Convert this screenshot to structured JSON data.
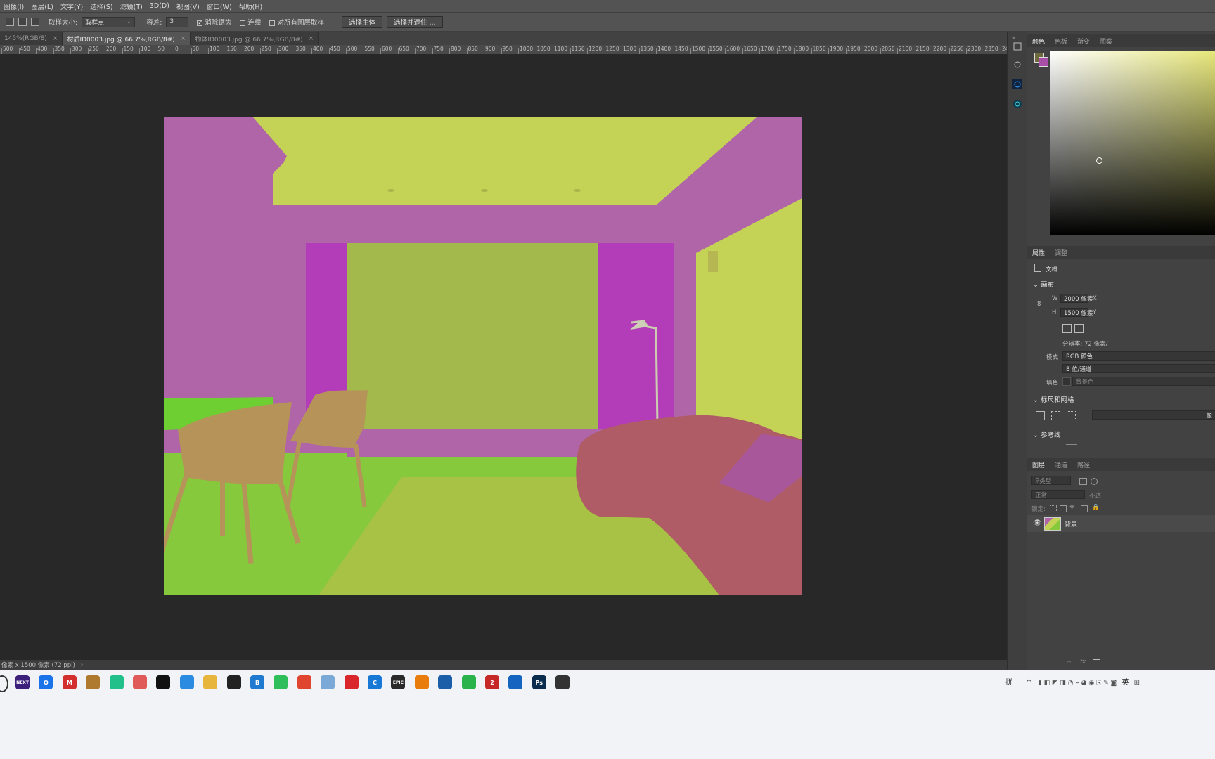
{
  "menu": [
    "图像(I)",
    "图层(L)",
    "文字(Y)",
    "选择(S)",
    "滤镜(T)",
    "3D(D)",
    "视图(V)",
    "窗口(W)",
    "帮助(H)"
  ],
  "options": {
    "sample_size_label": "取样大小:",
    "sample_size_value": "取样点",
    "tolerance_label": "容差:",
    "tolerance_value": "3",
    "antialias_label": "消除锯齿",
    "contiguous_label": "连续",
    "all_layers_label": "对所有图层取样",
    "select_subject": "选择主体",
    "select_mask": "选择并遮住 ..."
  },
  "tabs": [
    {
      "label": "145%(RGB/8)",
      "active": false
    },
    {
      "label": "材质ID0003.jpg @ 66.7%(RGB/8#)",
      "active": true
    },
    {
      "label": "物体ID0003.jpg @ 66.7%(RGB/8#)",
      "active": false
    }
  ],
  "ruler_ticks": [
    "500",
    "450",
    "400",
    "350",
    "300",
    "250",
    "200",
    "150",
    "100",
    "50",
    "0",
    "50",
    "100",
    "150",
    "200",
    "250",
    "300",
    "350",
    "400",
    "450",
    "500",
    "550",
    "600",
    "650",
    "700",
    "750",
    "800",
    "850",
    "900",
    "950",
    "1000",
    "1050",
    "1100",
    "1150",
    "1200",
    "1250",
    "1300",
    "1350",
    "1400",
    "1450",
    "1500",
    "1550",
    "1600",
    "1650",
    "1700",
    "1750",
    "1800",
    "1850",
    "1900",
    "1950",
    "2000",
    "2050",
    "2100",
    "2150",
    "2200",
    "2250",
    "2300",
    "2350",
    "2400",
    "2450",
    "2500",
    "26"
  ],
  "status": "像素 x 1500 像素 (72 ppi)",
  "color_panel": {
    "tabs": [
      "颜色",
      "色板",
      "渐变",
      "图案"
    ]
  },
  "properties": {
    "tabs": [
      "属性",
      "调整"
    ],
    "doc_label": "文档",
    "canvas_header": "画布",
    "w_label": "W",
    "w_value": "2000 像素",
    "h_label": "H",
    "h_value": "1500 像素",
    "x_label": "X",
    "y_label": "Y",
    "resolution": "分辨率: 72 像素/",
    "mode_label": "模式",
    "mode_value": "RGB 颜色",
    "depth_value": "8 位/通道",
    "fill_label": "填色",
    "fill_value": "背景色",
    "rulers_header": "标尺和网格",
    "guides_header": "参考线",
    "unit_value": "像"
  },
  "layers": {
    "tabs": [
      "图层",
      "通道",
      "路径"
    ],
    "search_placeholder": "类型",
    "blend_mode": "正常",
    "opacity_label": "不透",
    "lock_label": "锁定:",
    "layer_name": "背景"
  },
  "taskbar": {
    "apps": [
      {
        "name": "next-app",
        "text": "NEXT",
        "color": "#3b1f7a"
      },
      {
        "name": "browser-q",
        "text": "Q",
        "color": "#1a73e8"
      },
      {
        "name": "m-app",
        "text": "M",
        "color": "#d32f2f"
      },
      {
        "name": "game-app",
        "text": "",
        "color": "#b07a2e"
      },
      {
        "name": "dev-app",
        "text": "",
        "color": "#21c08b"
      },
      {
        "name": "red-app",
        "text": "",
        "color": "#e05a5a"
      },
      {
        "name": "x-app",
        "text": "",
        "color": "#111111"
      },
      {
        "name": "grid-app",
        "text": "",
        "color": "#2b8be0"
      },
      {
        "name": "folder-app",
        "text": "",
        "color": "#e8b53c"
      },
      {
        "name": "search-app",
        "text": "",
        "color": "#222222"
      },
      {
        "name": "b-app",
        "text": "B",
        "color": "#1f7ad0"
      },
      {
        "name": "green-app",
        "text": "",
        "color": "#2fbf5a"
      },
      {
        "name": "chrome-app",
        "text": "",
        "color": "#e0452f"
      },
      {
        "name": "box-app",
        "text": "",
        "color": "#7aa9d8"
      },
      {
        "name": "netease-app",
        "text": "",
        "color": "#d8262b"
      },
      {
        "name": "c-app",
        "text": "C",
        "color": "#1778d6"
      },
      {
        "name": "epic-app",
        "text": "EPIC",
        "color": "#2a2a2a"
      },
      {
        "name": "blender-app",
        "text": "",
        "color": "#e87d0d"
      },
      {
        "name": "globe-app",
        "text": "",
        "color": "#1b5fa8"
      },
      {
        "name": "wechat-app",
        "text": "",
        "color": "#29b34a"
      },
      {
        "name": "two-app",
        "text": "2",
        "color": "#c62828"
      },
      {
        "name": "photo-app",
        "text": "",
        "color": "#1565c0"
      },
      {
        "name": "ps-app",
        "text": "Ps",
        "color": "#0a2d4e"
      },
      {
        "name": "rec-app",
        "text": "",
        "color": "#333333"
      }
    ],
    "ime_label": "拼",
    "lang_label": "英"
  },
  "colors": {
    "menubar": "#535353",
    "workspace": "#282828",
    "pink": "#b065a8",
    "magenta": "#b33cb8",
    "yellow_green": "#c4d355",
    "olive": "#a3b94c",
    "green": "#86c93c",
    "chair": "#b59359",
    "sofa": "#b05c66"
  }
}
